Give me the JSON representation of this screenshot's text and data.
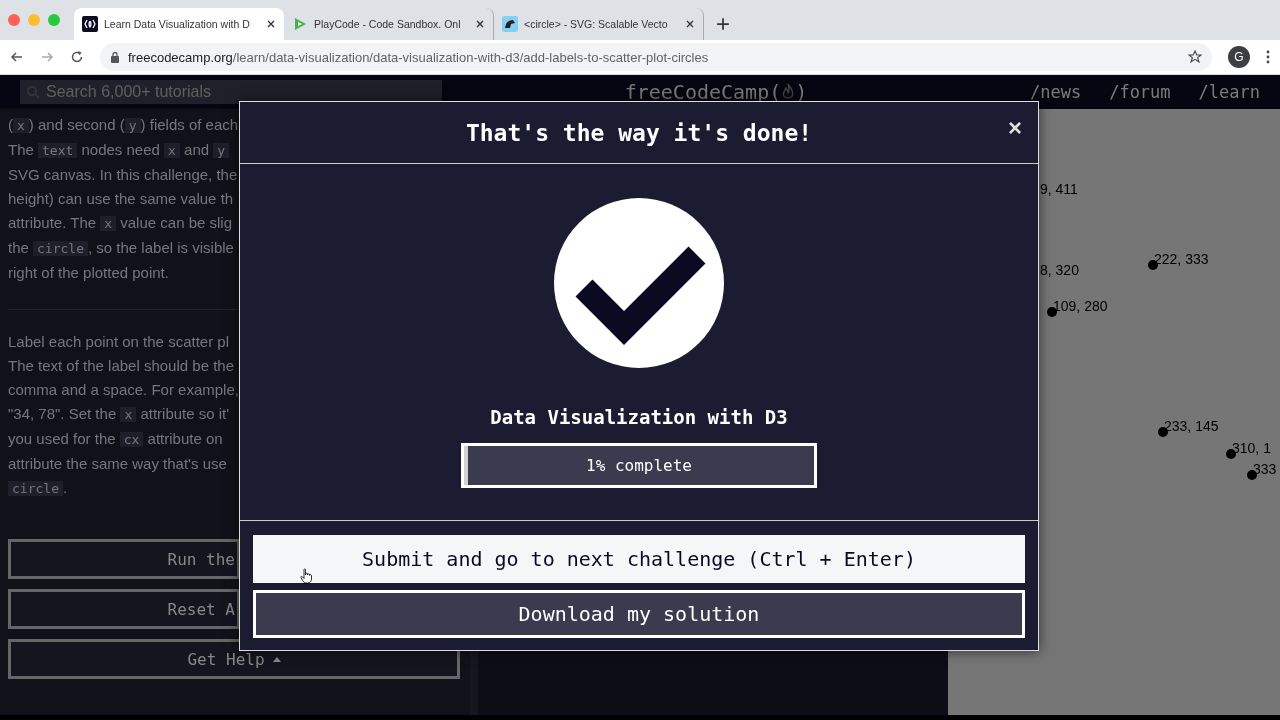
{
  "browser": {
    "tabs": [
      {
        "title": "Learn Data Visualization with D",
        "selected": true,
        "kind": "fcc"
      },
      {
        "title": "PlayCode - Code Sandbox. Onl",
        "selected": false,
        "kind": "playcode"
      },
      {
        "title": "<circle> - SVG: Scalable Vecto",
        "selected": false,
        "kind": "mdn"
      }
    ],
    "url_host": "freecodecamp.org",
    "url_path": "/learn/data-visualization/data-visualization-with-d3/add-labels-to-scatter-plot-circles",
    "avatar": "G"
  },
  "nav": {
    "search_placeholder": "Search 6,000+ tutorials",
    "logo_left": "freeCodeCamp(",
    "logo_right": ")",
    "links": [
      "/news",
      "/forum",
      "/learn"
    ]
  },
  "instructions": {
    "paragraph_1": [
      [
        {
          "t": "(",
          "kind": "prose"
        },
        {
          "t": "x",
          "kind": "code"
        },
        {
          "t": ") and second (",
          "kind": "prose"
        },
        {
          "t": "y",
          "kind": "code"
        },
        {
          "t": ") fields of each",
          "kind": "prose"
        }
      ],
      [
        {
          "t": "The ",
          "kind": "prose"
        },
        {
          "t": "text",
          "kind": "code"
        },
        {
          "t": " nodes need ",
          "kind": "prose"
        },
        {
          "t": "x",
          "kind": "code"
        },
        {
          "t": " and ",
          "kind": "prose"
        },
        {
          "t": "y",
          "kind": "code"
        }
      ],
      [
        {
          "t": "SVG canvas. In this challenge, the",
          "kind": "prose"
        }
      ],
      [
        {
          "t": "height) can use the same value th",
          "kind": "prose"
        }
      ],
      [
        {
          "t": "attribute. The ",
          "kind": "prose"
        },
        {
          "t": "x",
          "kind": "code"
        },
        {
          "t": " value can be slig",
          "kind": "prose"
        }
      ],
      [
        {
          "t": "the ",
          "kind": "prose"
        },
        {
          "t": "circle",
          "kind": "code"
        },
        {
          "t": ", so the label is visible",
          "kind": "prose"
        }
      ],
      [
        {
          "t": "right of the plotted point.",
          "kind": "prose"
        }
      ]
    ],
    "paragraph_2": [
      [
        {
          "t": "Label each point on the scatter pl",
          "kind": "prose"
        }
      ],
      [
        {
          "t": "The text of the label should be the",
          "kind": "prose"
        }
      ],
      [
        {
          "t": "comma and a space. For example,",
          "kind": "prose"
        }
      ],
      [
        {
          "t": "\"34, 78\". Set the ",
          "kind": "prose"
        },
        {
          "t": "x",
          "kind": "code"
        },
        {
          "t": " attribute so it'",
          "kind": "prose"
        }
      ],
      [
        {
          "t": "you used for the ",
          "kind": "prose"
        },
        {
          "t": "cx",
          "kind": "code"
        },
        {
          "t": " attribute on",
          "kind": "prose"
        }
      ],
      [
        {
          "t": "attribute the same way that's use",
          "kind": "prose"
        }
      ],
      [
        {
          "t": "circle",
          "kind": "code"
        },
        {
          "t": ".",
          "kind": "prose"
        }
      ]
    ]
  },
  "buttons": [
    {
      "label": "Run the",
      "kind": "cut"
    },
    {
      "label": "Reset A",
      "kind": "cut"
    },
    {
      "label": "Get Help",
      "kind": "menu"
    }
  ],
  "preview": {
    "points": [
      {
        "label": "9, 411",
        "kind": "label"
      },
      {
        "label": "8, 320",
        "kind": "label"
      },
      {
        "label": "222, 333",
        "kind": "dot"
      },
      {
        "label": "109, 280",
        "kind": "dot"
      },
      {
        "label": "233, 145",
        "kind": "dot"
      },
      {
        "label": "310, 1",
        "kind": "dot"
      },
      {
        "label": "333",
        "kind": "dot"
      }
    ]
  },
  "modal": {
    "title": "That's the way it's done!",
    "close": "×",
    "course": "Data Visualization with D3",
    "progress": {
      "text": "1% complete",
      "level": 0.01
    },
    "submit": "Submit and go to next challenge (Ctrl + Enter)",
    "download": "Download my solution"
  }
}
